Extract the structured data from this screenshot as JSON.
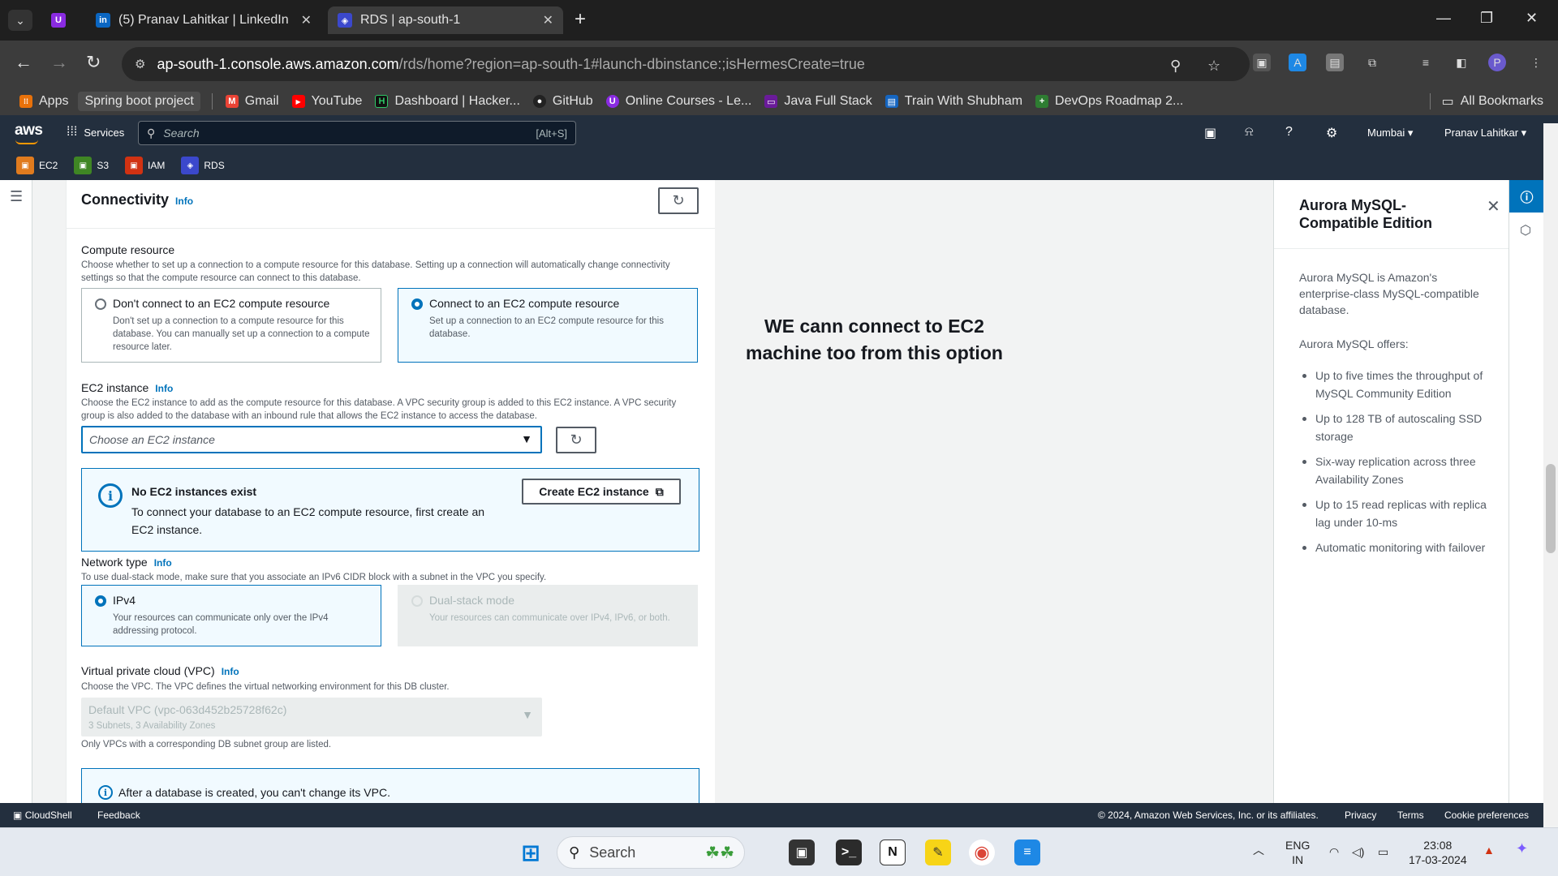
{
  "browser": {
    "tabs": [
      {
        "label": "(5) Pranav Lahitkar | LinkedIn",
        "icon": "linkedin-icon"
      },
      {
        "label": "RDS | ap-south-1",
        "icon": "rds-icon"
      }
    ],
    "url": {
      "host": "ap-south-1.console.aws.amazon.com",
      "path": "/rds/home?region=ap-south-1#launch-dbinstance:;isHermesCreate=true"
    },
    "bookmarks": [
      {
        "label": "Apps"
      },
      {
        "label": "Spring boot project"
      },
      {
        "label": "Gmail"
      },
      {
        "label": "YouTube"
      },
      {
        "label": "Dashboard | Hacker..."
      },
      {
        "label": "GitHub"
      },
      {
        "label": "Online Courses - Le..."
      },
      {
        "label": "Java Full Stack"
      },
      {
        "label": "Train With Shubham"
      },
      {
        "label": "DevOps Roadmap 2..."
      }
    ],
    "all_bookmarks": "All Bookmarks"
  },
  "aws": {
    "logo": "aws",
    "services": "Services",
    "search_placeholder": "Search",
    "search_shortcut": "[Alt+S]",
    "region": "Mumbai ▾",
    "user": "Pranav Lahitkar ▾",
    "favorites": [
      {
        "label": "EC2",
        "color": "#e07b1e"
      },
      {
        "label": "S3",
        "color": "#3f8624"
      },
      {
        "label": "IAM",
        "color": "#d13212"
      },
      {
        "label": "RDS",
        "color": "#3b48cc"
      }
    ]
  },
  "connectivity": {
    "title": "Connectivity",
    "info": "Info",
    "compute_label": "Compute resource",
    "compute_desc": "Choose whether to set up a connection to a compute resource for this database. Setting up a connection will automatically change connectivity settings so that the compute resource can connect to this database.",
    "option_no": {
      "title": "Don't connect to an EC2 compute resource",
      "desc": "Don't set up a connection to a compute resource for this database. You can manually set up a connection to a compute resource later."
    },
    "option_yes": {
      "title": "Connect to an EC2 compute resource",
      "desc": "Set up a connection to an EC2 compute resource for this database."
    },
    "ec2_label": "EC2 instance",
    "ec2_info": "Info",
    "ec2_desc": "Choose the EC2 instance to add as the compute resource for this database. A VPC security group is added to this EC2 instance. A VPC security group is also added to the database with an inbound rule that allows the EC2 instance to access the database.",
    "ec2_placeholder": "Choose an EC2 instance",
    "alert_title": "No EC2 instances exist",
    "alert_body": "To connect your database to an EC2 compute resource, first create an EC2 instance.",
    "create_btn": "Create EC2 instance",
    "network_label": "Network type",
    "network_info": "Info",
    "network_desc": "To use dual-stack mode, make sure that you associate an IPv6 CIDR block with a subnet in the VPC you specify.",
    "ipv4": {
      "title": "IPv4",
      "desc": "Your resources can communicate only over the IPv4 addressing protocol."
    },
    "dual": {
      "title": "Dual-stack mode",
      "desc": "Your resources can communicate over IPv4, IPv6, or both."
    },
    "vpc_label": "Virtual private cloud (VPC)",
    "vpc_info": "Info",
    "vpc_desc": "Choose the VPC. The VPC defines the virtual networking environment for this DB cluster.",
    "vpc_value": "Default VPC (vpc-063d452b25728f62c)",
    "vpc_sub": "3 Subnets, 3 Availability Zones",
    "vpc_note": "Only VPCs with a corresponding DB subnet group are listed.",
    "vpc_alert": "After a database is created, you can't change its VPC."
  },
  "annotation": "WE cann connect to EC2 machine too from this option",
  "help": {
    "title": "Aurora MySQL-Compatible Edition",
    "p1": "Aurora MySQL is Amazon's enterprise-class MySQL-compatible database.",
    "p2": "Aurora MySQL offers:",
    "bullets": [
      "Up to five times the throughput of MySQL Community Edition",
      "Up to 128 TB of autoscaling SSD storage",
      "Six-way replication across three Availability Zones",
      "Up to 15 read replicas with replica lag under 10-ms",
      "Automatic monitoring with failover"
    ]
  },
  "footer": {
    "cloudshell": "CloudShell",
    "feedback": "Feedback",
    "copyright": "© 2024, Amazon Web Services, Inc. or its affiliates.",
    "privacy": "Privacy",
    "terms": "Terms",
    "cookies": "Cookie preferences"
  },
  "taskbar": {
    "search": "Search",
    "lang1": "ENG",
    "lang2": "IN",
    "time": "23:08",
    "date": "17-03-2024"
  }
}
